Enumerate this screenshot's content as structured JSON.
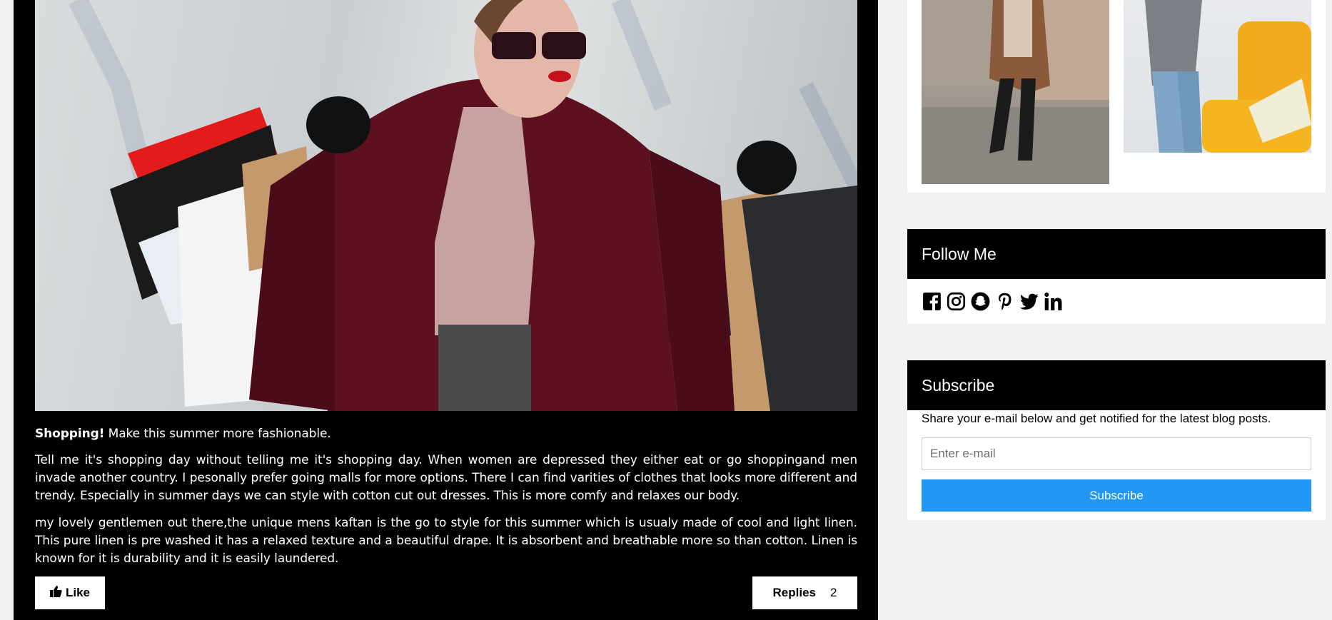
{
  "post": {
    "hero_alt": "woman-with-shopping-bags-photo",
    "lead_bold": "Shopping!",
    "lead_text": " Make this summer more fashionable.",
    "paragraph1": "Tell me it's shopping day without telling me it's shopping day. When women are depressed they either eat or go shoppingand men invade another country. I pesonally prefer going malls for more options. There I can find varities of clothes that looks more different and trendy. Especially in summer days we can style with cotton cut out dresses. This is more comfy and relaxes our body.",
    "paragraph2": "my lovely gentlemen out there,the unique mens kaftan is the go to style for this summer which is usualy made of cool and light linen. This pure linen is pre washed it has a relaxed texture and a beautiful drape. It is absorbent and breathable more so than cotton. Linen is known for it is durability and it is easily laundered.",
    "like_label": "Like",
    "replies_label": "Replies",
    "replies_count": "2"
  },
  "sidebar": {
    "follow": {
      "title": "Follow Me",
      "icons": [
        "facebook-icon",
        "instagram-icon",
        "snapchat-icon",
        "pinterest-icon",
        "twitter-icon",
        "linkedin-icon"
      ]
    },
    "subscribe": {
      "title": "Subscribe",
      "description": "Share your e-mail below and get notified for the latest blog posts.",
      "placeholder": "Enter e-mail",
      "button": "Subscribe"
    }
  },
  "colors": {
    "post_bg": "#000000",
    "page_bg": "#f1f1f1",
    "accent": "#2196f3"
  }
}
